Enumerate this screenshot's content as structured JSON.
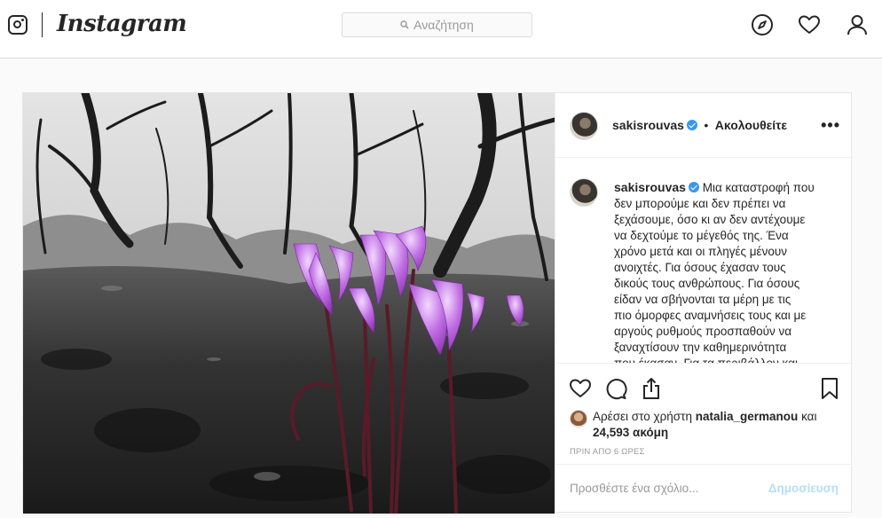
{
  "nav": {
    "wordmark": "Instagram",
    "search_placeholder": "Αναζήτηση",
    "icons": [
      "instagram-logo-icon",
      "search-icon",
      "explore-compass-icon",
      "heart-icon",
      "profile-icon"
    ]
  },
  "post": {
    "username": "sakisrouvas",
    "follow_separator": "•",
    "follow_state": "Ακολουθείτε",
    "more_label": "•••",
    "caption_lines": [
      "Μια καταστροφή που",
      "δεν μπορούμε και δεν πρέπει να",
      "ξεχάσουμε, όσο κι αν δεν αντέχουμε",
      "να δεχτούμε το μέγεθός της. Ένα",
      "χρόνο μετά και οι πληγές μένουν",
      "ανοιχτές. Για όσους έχασαν τους",
      "δικούς τους ανθρώπους. Για όσους",
      "είδαν να σβήνονται τα μέρη με τις",
      "πιο όμορφες αναμνήσεις τους και με",
      "αργούς ρυθμούς προσπαθούν να",
      "ξαναχτίσουν την καθημερινότητα",
      "που έκασαν. Για τα περιβάλλον και"
    ],
    "likes_prefix": "Αρέσει στο χρήστη",
    "liked_by": "natalia_germanou",
    "likes_and": "και",
    "likes_count": "24,593 ακόμη",
    "timestamp": "ΠΡΙΝ ΑΠΟ 6 ΩΡΕΣ",
    "comment_placeholder": "Προσθέστε ένα σχόλιο...",
    "post_button": "Δημοσίευση",
    "action_icons": [
      "like-heart-icon",
      "comment-icon",
      "share-icon",
      "save-bookmark-icon"
    ]
  },
  "colors": {
    "verified": "#3897f0",
    "post_button_disabled": "#b2dffc",
    "flower": "#b35ed6"
  }
}
